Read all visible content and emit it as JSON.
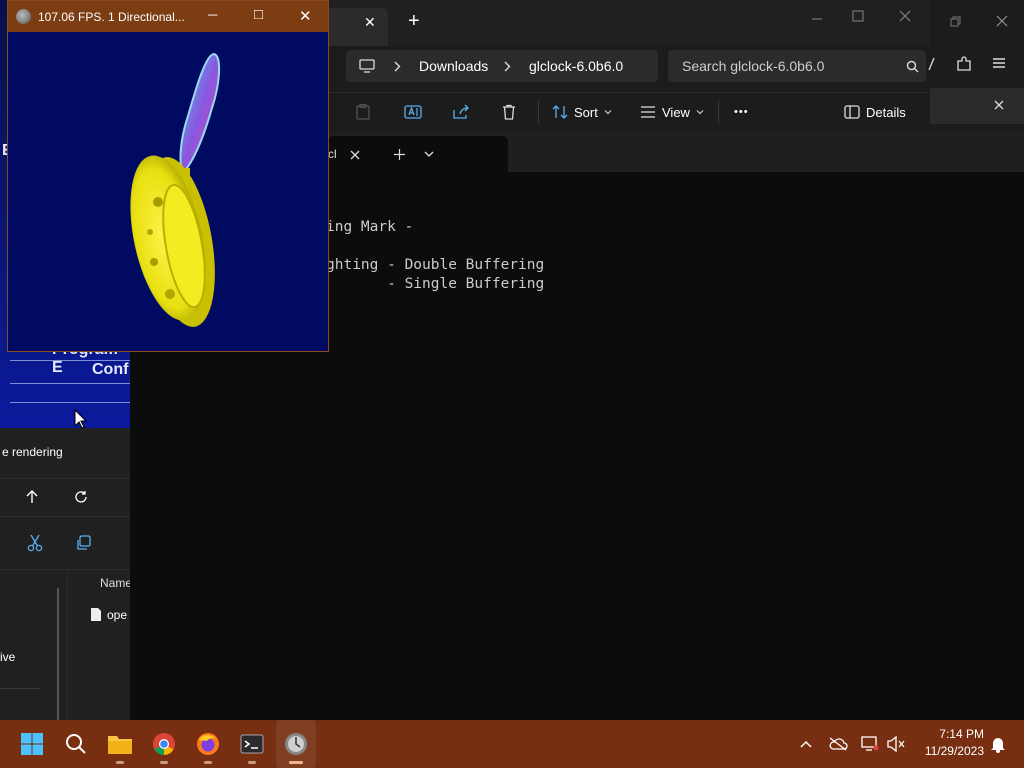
{
  "gl_window": {
    "title": "107.06 FPS.  1 Directional...",
    "minimize_glyph": "─",
    "maximize_glyph": "□",
    "close_glyph": "✕"
  },
  "explorer": {
    "new_tab_glyph": "+",
    "close_tab_glyph": "✕",
    "breadcrumb": [
      "Downloads",
      "glclock-6.0b6.0"
    ],
    "search_placeholder": "Search glclock-6.0b6.0",
    "sort_label": "Sort",
    "view_label": "View",
    "more_glyph": "•••",
    "details_label": "Details"
  },
  "right_strip": {
    "close_glyph": "✕"
  },
  "terminal": {
    "tab_title": "cl",
    "lines": [
      "ing Mark -",
      "",
      "ghting - Double Buffering",
      "       - Single Buffering"
    ]
  },
  "background_blue": {
    "letter": "E",
    "line1": "Program E",
    "line2": "Conf"
  },
  "background_explorer": {
    "title": "e rendering",
    "name_header": "Name",
    "file_name": "ope",
    "nav_item": "ive"
  },
  "taskbar": {
    "apps": [
      "start-menu",
      "search",
      "file-explorer",
      "chrome",
      "firefox",
      "terminal",
      "glclock"
    ],
    "time": "7:14 PM",
    "date": "11/29/2023"
  },
  "colors": {
    "taskbar": "#782e10",
    "gl_titlebar": "#7d3d12",
    "gl_background": "#000a60",
    "clock_gold": "#e8e010"
  }
}
